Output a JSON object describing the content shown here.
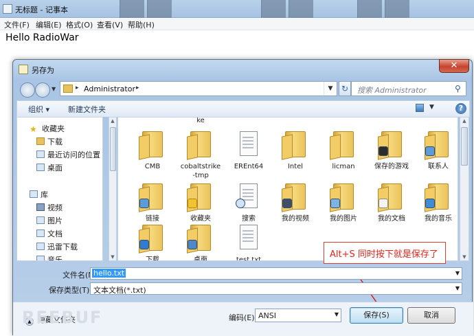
{
  "notepad": {
    "title": "无标题 - 记事本",
    "menu": [
      "文件(F)",
      "编辑(E)",
      "格式(O)",
      "查看(V)",
      "帮助(H)"
    ],
    "content": "Hello RadioWar"
  },
  "dialog": {
    "title": "另存为",
    "close_glyph": "✕",
    "address": {
      "crumb": "Administrator",
      "separator": "▸"
    },
    "search_placeholder": "搜索 Administrator",
    "toolbar": {
      "organize": "组织 ▾",
      "new_folder": "新建文件夹"
    },
    "nav": [
      {
        "label": "收藏夹",
        "icon": "star"
      },
      {
        "label": "下载",
        "icon": "fold"
      },
      {
        "label": "最近访问的位置",
        "icon": "box"
      },
      {
        "label": "桌面",
        "icon": "box"
      },
      {
        "label": "库",
        "icon": "box"
      },
      {
        "label": "视频",
        "icon": "film"
      },
      {
        "label": "图片",
        "icon": "box"
      },
      {
        "label": "文档",
        "icon": "box"
      },
      {
        "label": "迅雷下载",
        "icon": "box"
      },
      {
        "label": "音乐",
        "icon": "box"
      }
    ],
    "files_top_partial": "ke",
    "files": [
      {
        "name": "CMB",
        "kind": "folder"
      },
      {
        "name": "cobaltstrike-tmp",
        "kind": "folder"
      },
      {
        "name": "EREnt64",
        "kind": "folder"
      },
      {
        "name": "Intel",
        "kind": "folder"
      },
      {
        "name": "licman",
        "kind": "folder"
      },
      {
        "name": "保存的游戏",
        "kind": "folder"
      },
      {
        "name": "联系人",
        "kind": "folder"
      },
      {
        "name": "链接",
        "kind": "folder"
      },
      {
        "name": "收藏夹",
        "kind": "folder"
      },
      {
        "name": "搜索",
        "kind": "folder"
      },
      {
        "name": "我的视频",
        "kind": "folder"
      },
      {
        "name": "我的图片",
        "kind": "folder"
      },
      {
        "name": "我的文档",
        "kind": "folder"
      },
      {
        "name": "我的音乐",
        "kind": "folder"
      },
      {
        "name": "下载",
        "kind": "folder"
      },
      {
        "name": "桌面",
        "kind": "folder"
      },
      {
        "name": "test.txt",
        "kind": "file"
      }
    ],
    "annotation": "Alt+S 同时按下就是保存了",
    "form": {
      "filename_label": "文件名(N):",
      "filename_value": "hello.txt",
      "filetype_label": "保存类型(T):",
      "filetype_value": "文本文档(*.txt)"
    },
    "hide_folders": "隐藏文件夹",
    "encoding_label": "编码(E):",
    "encoding_value": "ANSI",
    "save_label": "保存(S)",
    "cancel_label": "取消"
  },
  "watermark": "REEBUF",
  "colors": {
    "annotation_red": "#e3261e",
    "selection_blue": "#3399ff"
  }
}
